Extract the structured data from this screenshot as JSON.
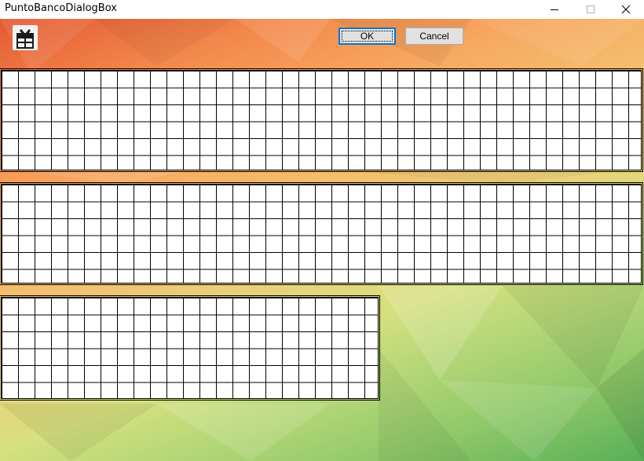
{
  "window": {
    "title": "PuntoBancoDialogBox",
    "controls": [
      "minimize-icon",
      "maximize-icon",
      "close-icon"
    ]
  },
  "toolbar": {
    "app_icon": "gift-icon",
    "ok_label": "OK",
    "cancel_label": "Cancel"
  },
  "grids": [
    {
      "name": "roadmap-grid-1",
      "columns": 39,
      "rows": 6
    },
    {
      "name": "roadmap-grid-2",
      "columns": 39,
      "rows": 6
    },
    {
      "name": "roadmap-grid-3",
      "columns": 23,
      "rows": 6
    }
  ],
  "colors": {
    "title_bar": "#ffffff",
    "gradient_start": "#e45a33",
    "gradient_end": "#59af57",
    "grid_line": "#000000",
    "grid_fill": "#ffffff",
    "button_face": "#e1e1e1",
    "focus_accent": "#0078d7"
  }
}
